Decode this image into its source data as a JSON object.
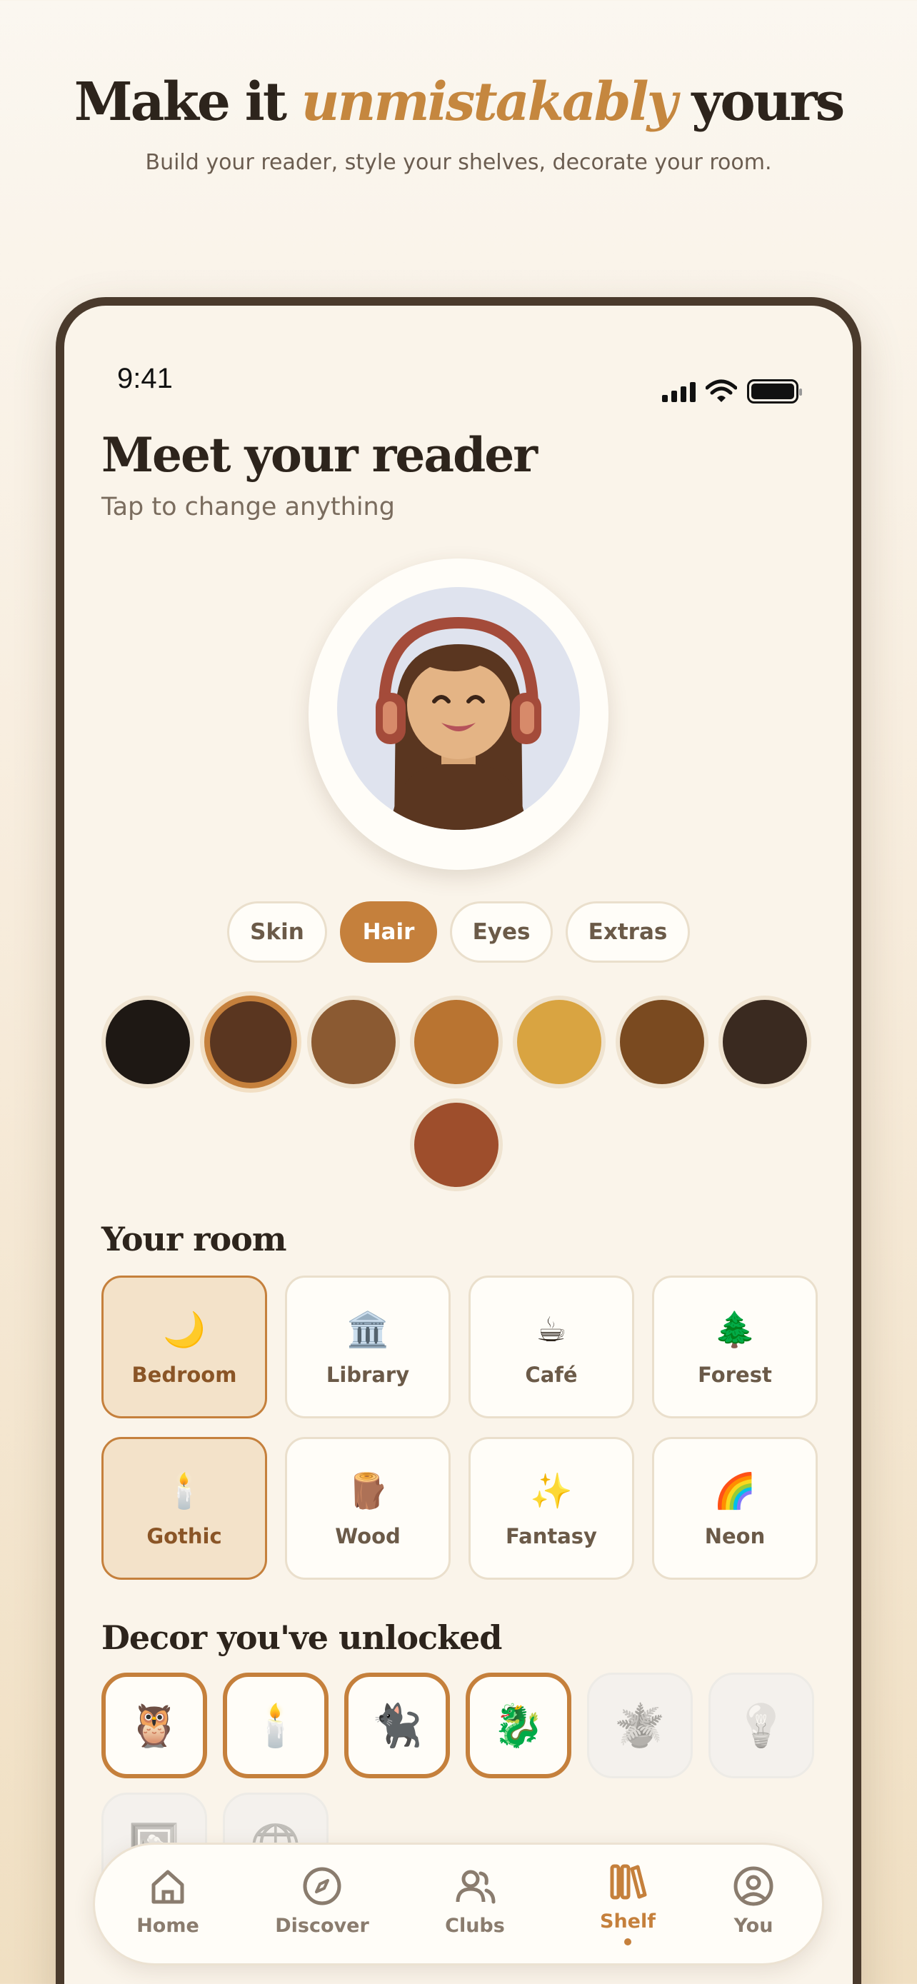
{
  "hero": {
    "title_part1": "Make it ",
    "title_accent": "unmistakably",
    "title_part2": " yours",
    "subtitle": "Build your reader, style your shelves, decorate your room."
  },
  "status_bar": {
    "time": "9:41"
  },
  "screen": {
    "title": "Meet your reader",
    "subtitle": "Tap to change anything"
  },
  "avatar_tabs": [
    {
      "label": "Skin",
      "active": false
    },
    {
      "label": "Hair",
      "active": true
    },
    {
      "label": "Eyes",
      "active": false
    },
    {
      "label": "Extras",
      "active": false
    }
  ],
  "hair_colors": [
    "#1e1814",
    "#5a3620",
    "#8b5a32",
    "#b97431",
    "#d9a441",
    "#7a4a20",
    "#3a2a20",
    "#9e4e2c"
  ],
  "selected_hair_color_index": 1,
  "room_section": {
    "title": "Your room",
    "rooms": [
      {
        "label": "Bedroom",
        "emoji": "🌙",
        "selected": true
      },
      {
        "label": "Library",
        "emoji": "🏛️",
        "selected": false
      },
      {
        "label": "Café",
        "emoji": "☕",
        "selected": false
      },
      {
        "label": "Forest",
        "emoji": "🌲",
        "selected": false
      },
      {
        "label": "Gothic",
        "emoji": "🕯️",
        "selected": true
      },
      {
        "label": "Wood",
        "emoji": "🪵",
        "selected": false
      },
      {
        "label": "Fantasy",
        "emoji": "✨",
        "selected": false
      },
      {
        "label": "Neon",
        "emoji": "🌈",
        "selected": false
      }
    ]
  },
  "decor_section": {
    "title": "Decor you've unlocked",
    "items": [
      {
        "name": "owl",
        "emoji": "🦉",
        "unlocked": true
      },
      {
        "name": "candle",
        "emoji": "🕯️",
        "unlocked": true
      },
      {
        "name": "cat",
        "emoji": "🐈‍⬛",
        "unlocked": true
      },
      {
        "name": "dragon",
        "emoji": "🐉",
        "unlocked": true
      },
      {
        "name": "plant",
        "emoji": "🪴",
        "unlocked": false
      },
      {
        "name": "bulb",
        "emoji": "💡",
        "unlocked": false
      },
      {
        "name": "frame",
        "emoji": "🖼️",
        "unlocked": false
      },
      {
        "name": "globe",
        "emoji": "🌐",
        "unlocked": false
      }
    ]
  },
  "nav": [
    {
      "label": "Home",
      "icon": "home-icon",
      "active": false
    },
    {
      "label": "Discover",
      "icon": "compass-icon",
      "active": false
    },
    {
      "label": "Clubs",
      "icon": "users-icon",
      "active": false
    },
    {
      "label": "Shelf",
      "icon": "shelf-icon",
      "active": true
    },
    {
      "label": "You",
      "icon": "profile-icon",
      "active": false
    }
  ],
  "colors": {
    "accent": "#c5803c",
    "text_dark": "#2d241c",
    "background": "#faf4ea"
  }
}
